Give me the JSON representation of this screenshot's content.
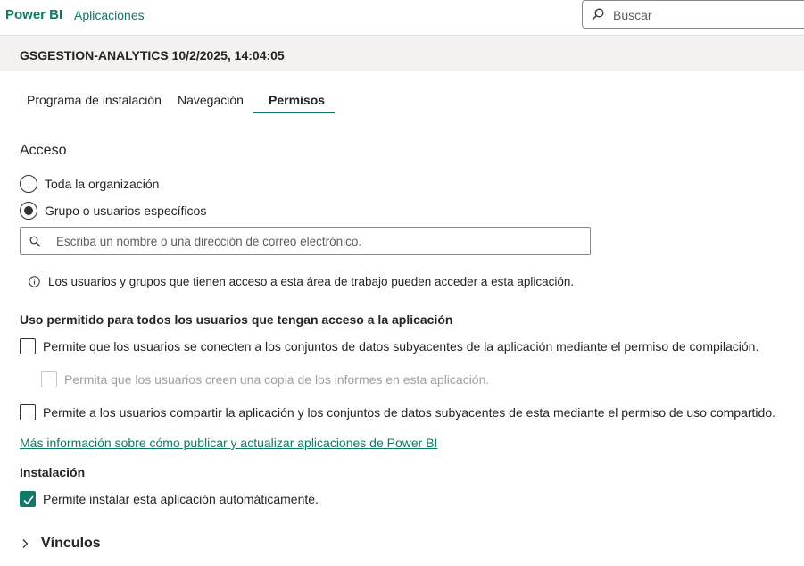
{
  "topbar": {
    "brand": "Power BI",
    "apps_link": "Aplicaciones",
    "search_placeholder": "Buscar"
  },
  "header": {
    "title": "GSGESTION-ANALYTICS 10/2/2025, 14:04:05"
  },
  "tabs": [
    {
      "label": "Programa de instalación",
      "active": false
    },
    {
      "label": "Navegación",
      "active": false
    },
    {
      "label": "Permisos",
      "active": true
    }
  ],
  "access": {
    "title": "Acceso",
    "options": [
      {
        "label": "Toda la organización",
        "selected": false
      },
      {
        "label": "Grupo o usuarios específicos",
        "selected": true
      }
    ],
    "people_placeholder": "Escriba un nombre o una dirección de correo electrónico.",
    "info": "Los usuarios y grupos que tienen acceso a esta área de trabajo pueden acceder a esta aplicación."
  },
  "usage": {
    "title": "Uso permitido para todos los usuarios que tengan acceso a la aplicación",
    "build": {
      "label": "Permite que los usuarios se conecten a los conjuntos de datos subyacentes de la aplicación mediante el permiso de compilación.",
      "checked": false
    },
    "copy": {
      "label": "Permita que los usuarios creen una copia de los informes en esta aplicación.",
      "checked": false,
      "disabled": true
    },
    "share": {
      "label": "Permite a los usuarios compartir la aplicación y los conjuntos de datos subyacentes de esta mediante el permiso de uso compartido.",
      "checked": false
    }
  },
  "more_info_link": "Más información sobre cómo publicar y actualizar aplicaciones de Power BI",
  "install": {
    "title": "Instalación",
    "auto": {
      "label": "Permite instalar esta aplicación automáticamente.",
      "checked": true
    }
  },
  "links_section": {
    "label": "Vínculos"
  },
  "colors": {
    "accent": "#117865",
    "header_bg": "#f3f2f1"
  }
}
